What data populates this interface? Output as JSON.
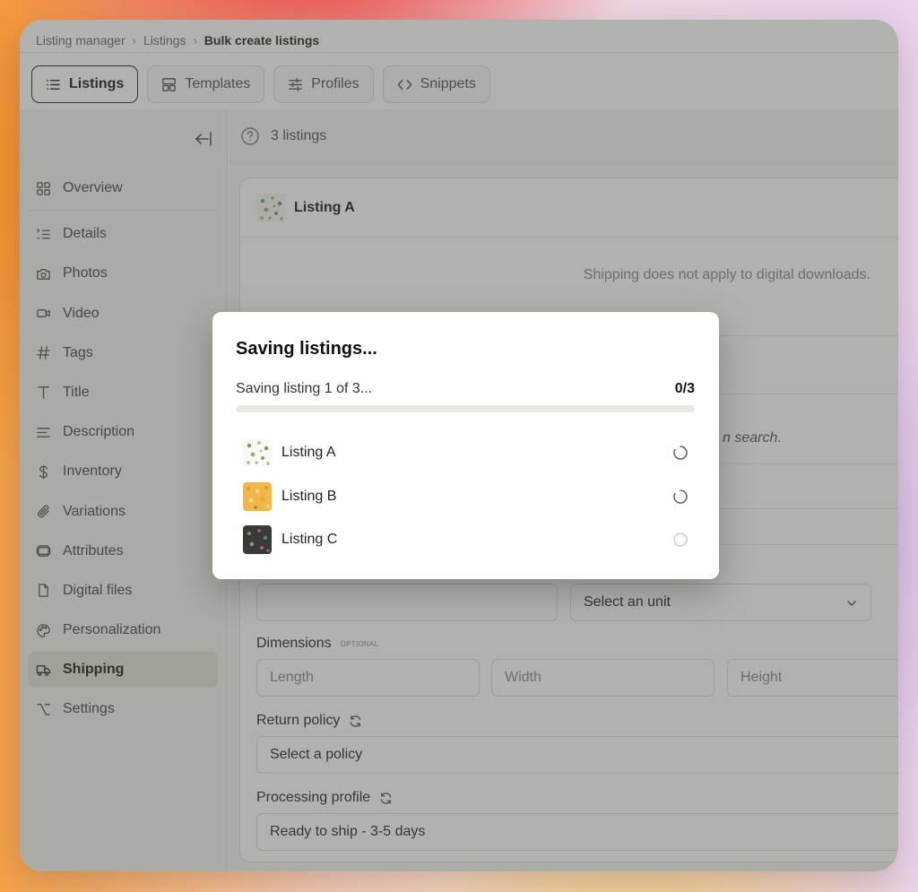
{
  "breadcrumb": {
    "items": [
      "Listing manager",
      "Listings"
    ],
    "current": "Bulk create listings"
  },
  "tabs": [
    {
      "label": "Listings",
      "icon": "list-icon",
      "active": true
    },
    {
      "label": "Templates",
      "icon": "template-icon",
      "active": false
    },
    {
      "label": "Profiles",
      "icon": "sliders-icon",
      "active": false
    },
    {
      "label": "Snippets",
      "icon": "code-icon",
      "active": false
    }
  ],
  "sidebar": {
    "items": [
      {
        "label": "Overview",
        "icon": "grid-icon"
      },
      {
        "label": "Details",
        "icon": "list-details-icon"
      },
      {
        "label": "Photos",
        "icon": "camera-icon"
      },
      {
        "label": "Video",
        "icon": "video-icon"
      },
      {
        "label": "Tags",
        "icon": "hash-icon"
      },
      {
        "label": "Title",
        "icon": "title-icon"
      },
      {
        "label": "Description",
        "icon": "align-left-icon"
      },
      {
        "label": "Inventory",
        "icon": "dollar-icon"
      },
      {
        "label": "Variations",
        "icon": "paperclip-icon"
      },
      {
        "label": "Attributes",
        "icon": "cube-icon"
      },
      {
        "label": "Digital files",
        "icon": "file-icon"
      },
      {
        "label": "Personalization",
        "icon": "palette-icon"
      },
      {
        "label": "Shipping",
        "icon": "truck-icon",
        "active": true
      },
      {
        "label": "Settings",
        "icon": "option-key-icon"
      }
    ]
  },
  "main": {
    "count_label": "3 listings",
    "card_title": "Listing A",
    "shipping_note": "Shipping does not apply to digital downloads.",
    "search_fragment": "n search.",
    "unit_select": "Select an unit",
    "dimensions_label": "Dimensions",
    "optional_tag": "OPTIONAL",
    "length_placeholder": "Length",
    "width_placeholder": "Width",
    "height_placeholder": "Height",
    "return_policy_label": "Return policy",
    "return_policy_value": "Select a policy",
    "processing_label": "Processing profile",
    "processing_value": "Ready to ship - 3-5 days"
  },
  "modal": {
    "title": "Saving listings...",
    "progress_label": "Saving listing 1 of 3...",
    "progress_count": "0/3",
    "progress_fraction": 0,
    "items": [
      {
        "label": "Listing A",
        "status": "loading"
      },
      {
        "label": "Listing B",
        "status": "loading"
      },
      {
        "label": "Listing C",
        "status": "pending"
      }
    ]
  },
  "colors": {
    "accent": "#2b2b2b",
    "overlay": "#46463c",
    "thumb_b": "#f0b84a",
    "thumb_c": "#3a3a3a"
  }
}
